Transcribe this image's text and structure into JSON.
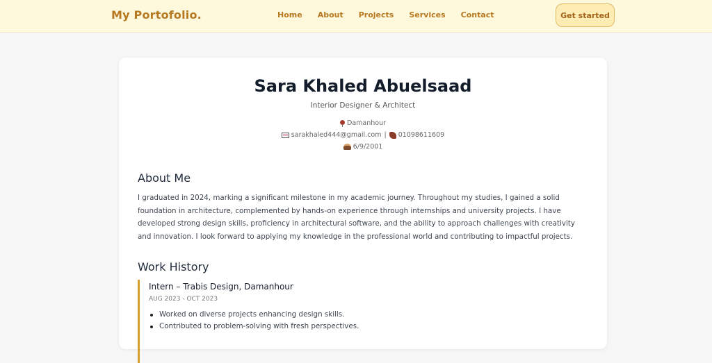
{
  "nav": {
    "brand": "My Portofolio.",
    "links": [
      "Home",
      "About",
      "Projects",
      "Services",
      "Contact"
    ],
    "cta": "Get started"
  },
  "profile": {
    "name": "Sara Khaled Abuelsaad",
    "title": "Interior Designer & Architect",
    "location": "Damanhour",
    "email": "sarakhaled444@gmail.com",
    "separator": "|",
    "phone": "01098611609",
    "birthdate": "6/9/2001",
    "icons": [
      "pin-icon",
      "envelope-icon",
      "phone-icon",
      "birthday-cake-icon"
    ]
  },
  "about": {
    "heading": "About Me",
    "text": "I graduated in 2024, marking a significant milestone in my academic journey. Throughout my studies, I gained a solid foundation in architecture, complemented by hands-on experience through internships and university projects. I have developed strong design skills, proficiency in architectural software, and the ability to approach challenges with creativity and innovation. I look forward to applying my knowledge in the professional world and contributing to impactful projects."
  },
  "work": {
    "heading": "Work History",
    "jobs": [
      {
        "title": "Intern – Trabis Design, Damanhour",
        "date": "AUG 2023 - OCT 2023",
        "bullets": [
          "Worked on diverse projects enhancing design skills.",
          "Contributed to problem-solving with fresh perspectives."
        ]
      }
    ]
  },
  "colors": {
    "navbar_bg": "#fef8dc",
    "accent": "#b7791f",
    "job_border": "#d69e2e",
    "page_bg": "#f6f6f6"
  }
}
